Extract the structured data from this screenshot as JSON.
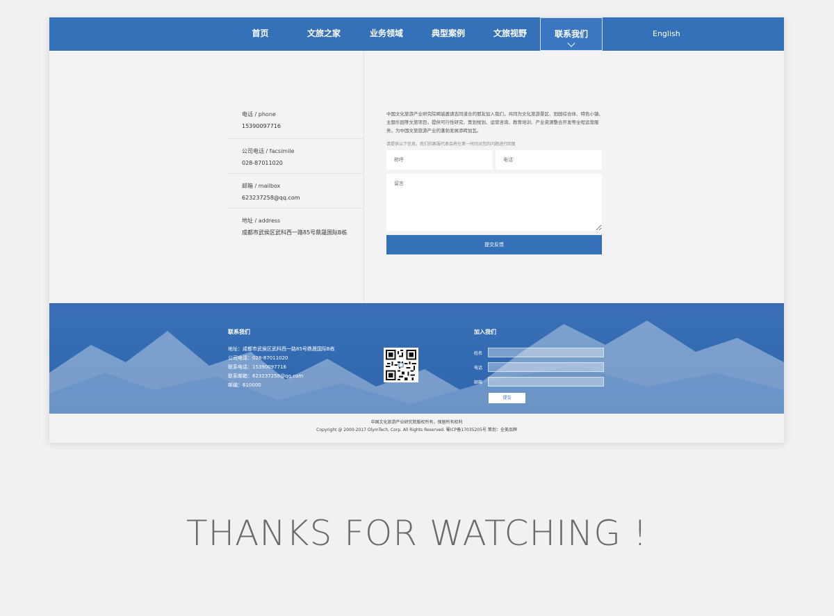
{
  "nav": {
    "items": [
      {
        "label": "首页"
      },
      {
        "label": "文旅之家"
      },
      {
        "label": "业务领域"
      },
      {
        "label": "典型案例"
      },
      {
        "label": "文旅视野"
      },
      {
        "label": "联系我们",
        "active": true
      }
    ],
    "lang": "English",
    "accent": "#3571b8"
  },
  "contact": {
    "items": [
      {
        "label": "电话 / phone",
        "value": "15390097716"
      },
      {
        "label": "公司电话 / facsimile",
        "value": "028-87011020"
      },
      {
        "label": "邮箱 / mailbox",
        "value": "623237258@qq.com"
      },
      {
        "label": "地址 / address",
        "value": "成都市武侯区武科西一路85号鼎晟国际B栋"
      }
    ]
  },
  "form": {
    "intro": "中国文化旅游产业研究院竭诚邀请志同道合的朋友加入我们，共同为文化旅游景区、田园综合体、特色小镇、主题乐园等文旅项目，提供可行性研究、策划规划、运营咨询、教育培训、产业资源整合开发等全程运营服务，为中国文旅旅游产业的蓬勃发展添砖加瓦。",
    "hint": "请提供以下信息，我们的客服代表会将在第一时间对您的问题进行回复",
    "name_placeholder": "称呼",
    "phone_placeholder": "电话",
    "message_placeholder": "留言",
    "submit_label": "提交反馈"
  },
  "footer": {
    "contact_title": "联系我们",
    "lines": [
      "地址：成都市武侯区武科西一路85号鼎晟国际B栋",
      "公司电话：028-87011020",
      "联系电话：15390097716",
      "联系邮箱：623237258@qq.com",
      "邮编：610000"
    ],
    "join_title": "加入我们",
    "join_fields": [
      "姓名",
      "电话",
      "邮箱"
    ],
    "join_submit": "提交"
  },
  "copyright": {
    "line1": "中国文化旅游产业研究院版权所有，保留所有权利",
    "line2": "Copyright @ 2000-2017 OlymTech, Corp. All Rights Reserved. 蜀ICP备17035205号  策划：全美品牌"
  },
  "thanks": "THANKS FOR WATCHING !"
}
